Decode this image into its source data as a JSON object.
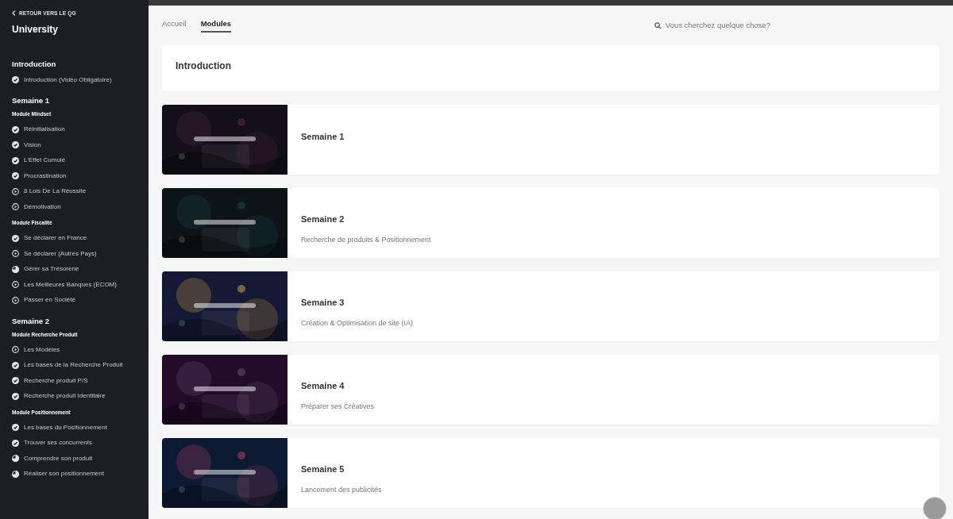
{
  "sidebar": {
    "back_link": "RETOUR VERS LE QG",
    "title": "University",
    "sections": [
      {
        "title": "Introduction",
        "groups": [
          {
            "items": [
              {
                "label": "Introduction (Vidéo Obligatoire)",
                "kind": "done"
              }
            ]
          }
        ]
      },
      {
        "title": "Semaine 1",
        "groups": [
          {
            "title": "Module Mindset",
            "items": [
              {
                "label": "Réinitialisation",
                "kind": "done"
              },
              {
                "label": "Vision",
                "kind": "done"
              },
              {
                "label": "L'Effet Cumulé",
                "kind": "done"
              },
              {
                "label": "Procrastination",
                "kind": "done"
              },
              {
                "label": "8 Lois De La Réussite",
                "kind": "todo"
              },
              {
                "label": "Démotivation",
                "kind": "todo"
              }
            ]
          },
          {
            "title": "Module Fiscalité",
            "items": [
              {
                "label": "Se déclarer en France",
                "kind": "done"
              },
              {
                "label": "Se déclarer (Autres Pays)",
                "kind": "todo"
              },
              {
                "label": "Gérer sa Trésorerie",
                "kind": "progress"
              },
              {
                "label": "Les Meilleures Banques (ECOM)",
                "kind": "todo"
              },
              {
                "label": "Passer en Société",
                "kind": "todo"
              }
            ]
          }
        ]
      },
      {
        "title": "Semaine 2",
        "groups": [
          {
            "title": "Module Recherche Produit",
            "items": [
              {
                "label": "Les Modèles",
                "kind": "todo"
              },
              {
                "label": "Les bases de la Recherche Produit",
                "kind": "done"
              },
              {
                "label": "Recherche produit P/S",
                "kind": "done"
              },
              {
                "label": "Recherche produit Identitaire",
                "kind": "done"
              }
            ]
          },
          {
            "title": "Module Positionnement",
            "items": [
              {
                "label": "Les bases du Positionnement",
                "kind": "done"
              },
              {
                "label": "Trouver ses concurrents",
                "kind": "done"
              },
              {
                "label": "Comprendre son produit",
                "kind": "progress"
              },
              {
                "label": "Réaliser son positionnement",
                "kind": "progress"
              }
            ]
          }
        ]
      }
    ]
  },
  "tabs": [
    {
      "label": "Accueil",
      "selected": false
    },
    {
      "label": "Modules",
      "selected": true
    }
  ],
  "search": {
    "placeholder": "Vous cherchez quelque chose?"
  },
  "intro_card": {
    "title": "Introduction"
  },
  "modules": [
    {
      "title": "Semaine 1"
    },
    {
      "title": "Semaine 2",
      "subtitle": "Recherche de produits & Positionnement"
    },
    {
      "title": "Semaine 3",
      "subtitle": "Création & Optimisation de site (IA)"
    },
    {
      "title": "Semaine 4",
      "subtitle": "Préparer ses Créatives"
    },
    {
      "title": "Semaine 5",
      "subtitle": "Lancement des publicités"
    }
  ]
}
